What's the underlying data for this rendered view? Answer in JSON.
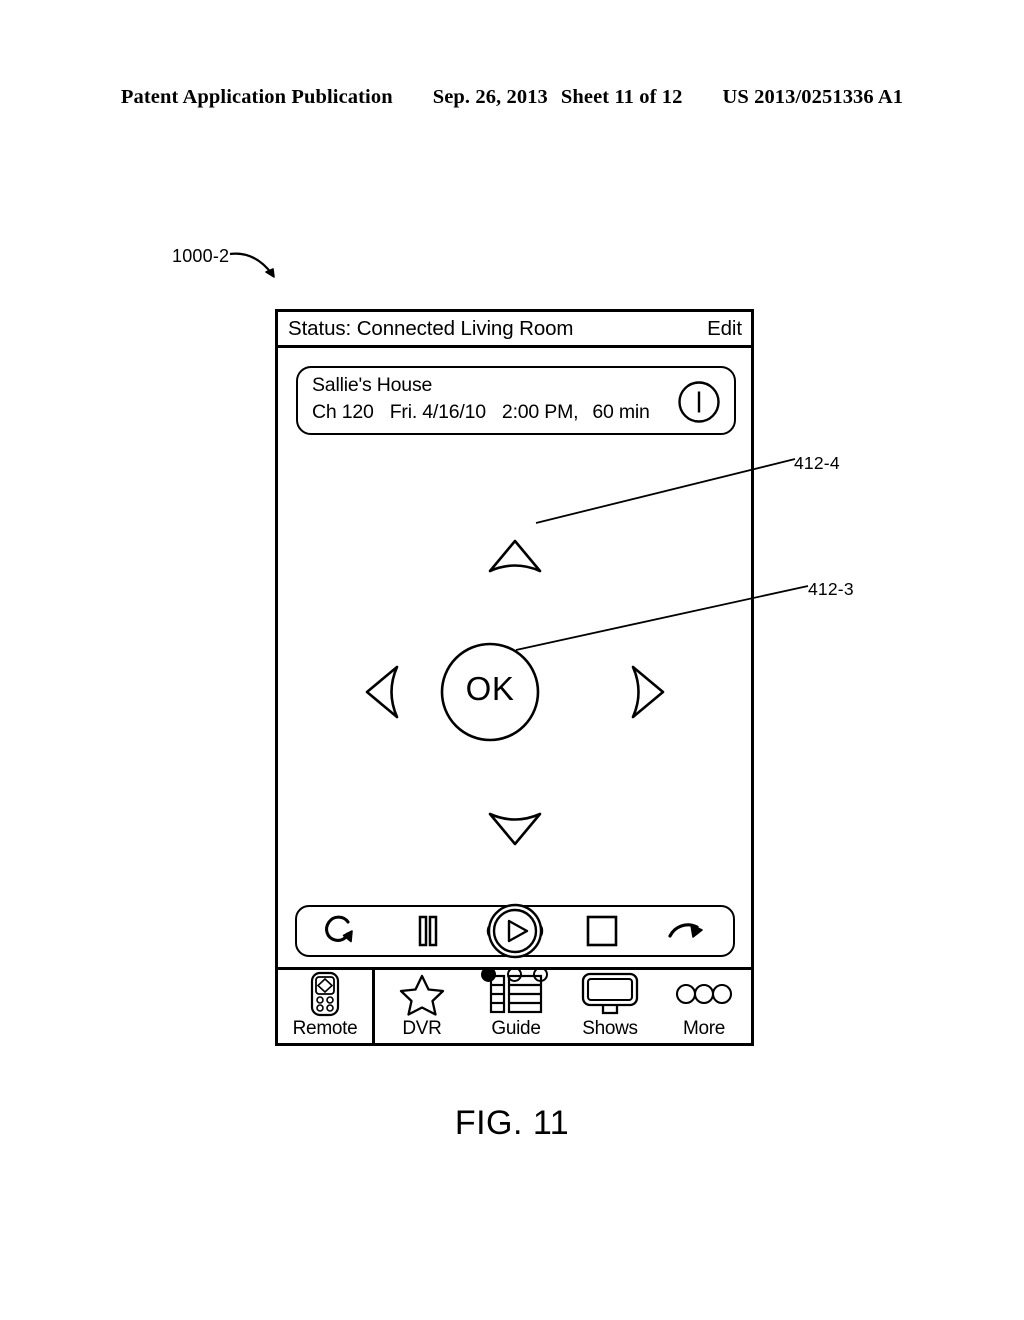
{
  "publication_header": {
    "left": "Patent Application Publication",
    "date": "Sep. 26, 2013",
    "sheet": "Sheet 11 of 12",
    "number": "US 2013/0251336 A1"
  },
  "figure": {
    "reference_label": "1000-2",
    "caption": "FIG. 11",
    "callouts": [
      {
        "label": "412-4",
        "target": "up-arrow-button"
      },
      {
        "label": "412-3",
        "target": "ok-button"
      }
    ]
  },
  "device": {
    "status_bar": {
      "status_text": "Status: Connected Living Room",
      "edit_label": "Edit"
    },
    "program_card": {
      "title": "Sallie's House",
      "channel": "Ch 120",
      "date": "Fri. 4/16/10",
      "time": "2:00 PM,",
      "duration": "60 min",
      "info_icon": "info-bar-circle-icon"
    },
    "dpad": {
      "ok_label": "OK",
      "up_icon": "up-arrow-icon",
      "down_icon": "down-arrow-icon",
      "left_icon": "left-arrow-icon",
      "right_icon": "right-arrow-icon"
    },
    "transport": [
      {
        "name": "replay-button",
        "icon": "replay-loop-icon"
      },
      {
        "name": "pause-button",
        "icon": "pause-icon"
      },
      {
        "name": "play-button",
        "icon": "play-icon"
      },
      {
        "name": "stop-button",
        "icon": "stop-square-icon"
      },
      {
        "name": "skip-forward-button",
        "icon": "forward-curved-arrow-icon"
      }
    ],
    "page_indicator": {
      "total": 3,
      "active_index": 0
    },
    "tabs": [
      {
        "label": "Remote",
        "icon": "remote-control-icon",
        "selected": true
      },
      {
        "label": "DVR",
        "icon": "star-icon",
        "selected": false
      },
      {
        "label": "Guide",
        "icon": "grid-list-icon",
        "selected": false
      },
      {
        "label": "Shows",
        "icon": "television-icon",
        "selected": false
      },
      {
        "label": "More",
        "icon": "three-dots-icon",
        "selected": false
      }
    ]
  },
  "colors": {
    "ink": "#000000",
    "paper": "#ffffff"
  }
}
